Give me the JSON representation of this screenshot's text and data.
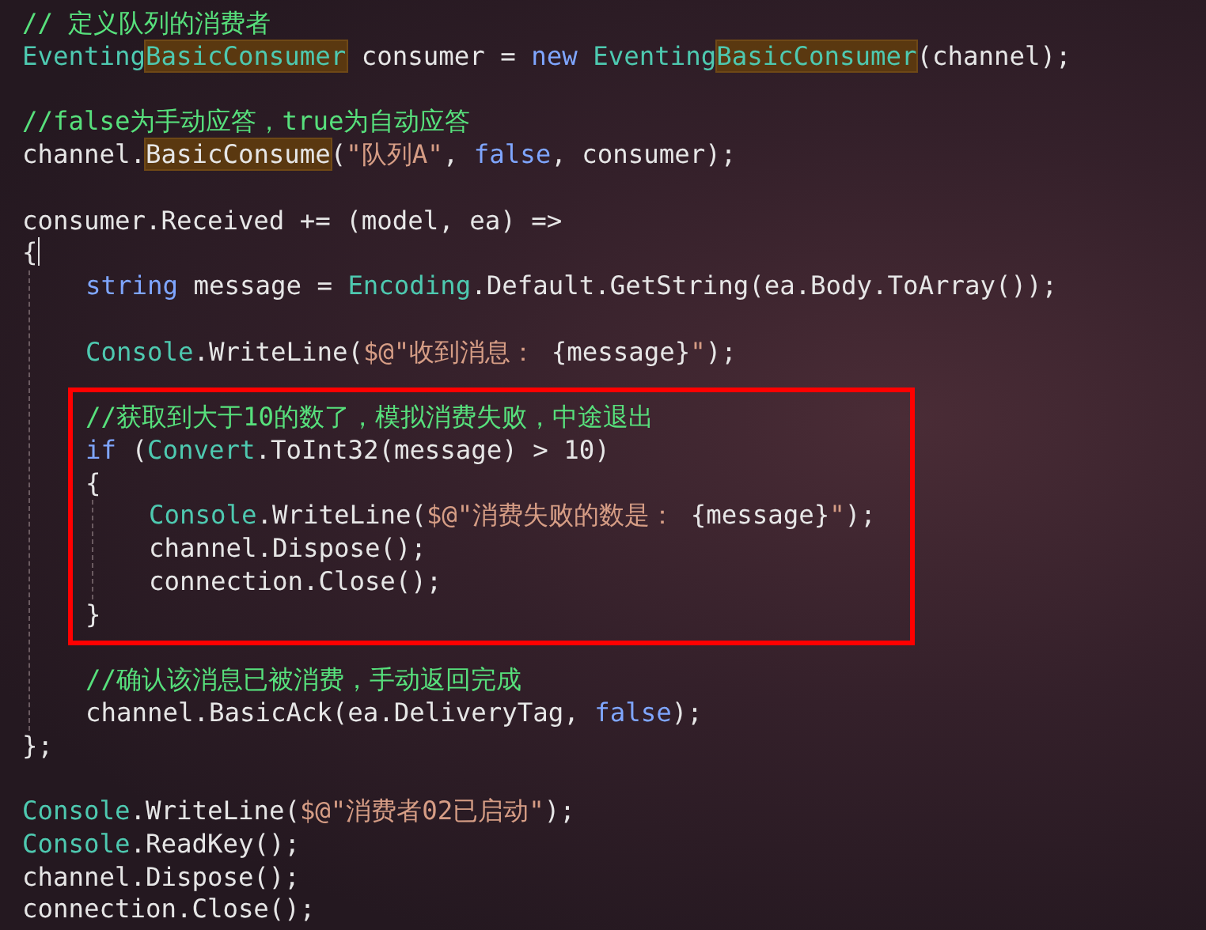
{
  "lines": [
    {
      "kind": "code",
      "tokens": [
        {
          "text": "// 定义队列的消费者",
          "kind": "comment"
        }
      ]
    },
    {
      "kind": "code",
      "tokens": [
        {
          "text": "Eventing",
          "kind": "type"
        },
        {
          "text": "BasicConsumer",
          "kind": "typematch"
        },
        {
          "text": " consumer = ",
          "kind": "plain"
        },
        {
          "text": "new ",
          "kind": "keyword"
        },
        {
          "text": "Eventing",
          "kind": "type"
        },
        {
          "text": "BasicConsumer",
          "kind": "typematch"
        },
        {
          "text": "(channel);",
          "kind": "plain"
        }
      ]
    },
    {
      "kind": "blank"
    },
    {
      "kind": "code",
      "tokens": [
        {
          "text": "//false为手动应答，true为自动应答",
          "kind": "comment"
        }
      ]
    },
    {
      "kind": "code",
      "tokens": [
        {
          "text": "channel.",
          "kind": "plain"
        },
        {
          "text": "BasicConsume",
          "kind": "plainmatch"
        },
        {
          "text": "(",
          "kind": "plain"
        },
        {
          "text": "\"队列A\"",
          "kind": "string"
        },
        {
          "text": ", ",
          "kind": "plain"
        },
        {
          "text": "false",
          "kind": "keyword"
        },
        {
          "text": ", consumer);",
          "kind": "plain"
        }
      ]
    },
    {
      "kind": "blank"
    },
    {
      "kind": "code",
      "tokens": [
        {
          "text": "consumer.Received += (model, ea) =>",
          "kind": "plain"
        }
      ]
    },
    {
      "kind": "code",
      "caret": true,
      "tokens": [
        {
          "text": "{",
          "kind": "plain"
        }
      ],
      "children": [
        {
          "kind": "code",
          "tokens": [
            {
              "text": "string",
              "kind": "keyword"
            },
            {
              "text": " message = ",
              "kind": "plain"
            },
            {
              "text": "Encoding",
              "kind": "type"
            },
            {
              "text": ".Default.GetString(ea.Body.ToArray());",
              "kind": "plain"
            }
          ]
        },
        {
          "kind": "blank"
        },
        {
          "kind": "code",
          "tokens": [
            {
              "text": "Console",
              "kind": "type"
            },
            {
              "text": ".WriteLine(",
              "kind": "plain"
            },
            {
              "text": "$@\"收到消息： ",
              "kind": "string"
            },
            {
              "text": "{message}",
              "kind": "plain"
            },
            {
              "text": "\"",
              "kind": "string"
            },
            {
              "text": ");",
              "kind": "plain"
            }
          ]
        },
        {
          "kind": "blank"
        },
        {
          "kind": "box",
          "children": [
            {
              "kind": "code",
              "tokens": [
                {
                  "text": "//获取到大于10的数了，模拟消费失败，中途退出",
                  "kind": "comment"
                }
              ]
            },
            {
              "kind": "code",
              "tokens": [
                {
                  "text": "if",
                  "kind": "keyword"
                },
                {
                  "text": " (",
                  "kind": "plain"
                },
                {
                  "text": "Convert",
                  "kind": "type"
                },
                {
                  "text": ".ToInt32(message) > 10)",
                  "kind": "plain"
                }
              ]
            },
            {
              "kind": "code",
              "tokens": [
                {
                  "text": "{",
                  "kind": "plain"
                }
              ],
              "children": [
                {
                  "kind": "code",
                  "tokens": [
                    {
                      "text": "Console",
                      "kind": "type"
                    },
                    {
                      "text": ".WriteLine(",
                      "kind": "plain"
                    },
                    {
                      "text": "$@\"消费失败的数是： ",
                      "kind": "string"
                    },
                    {
                      "text": "{message}",
                      "kind": "plain"
                    },
                    {
                      "text": "\"",
                      "kind": "string"
                    },
                    {
                      "text": ");",
                      "kind": "plain"
                    }
                  ]
                },
                {
                  "kind": "code",
                  "tokens": [
                    {
                      "text": "channel.Dispose();",
                      "kind": "plain"
                    }
                  ]
                },
                {
                  "kind": "code",
                  "tokens": [
                    {
                      "text": "connection.Close();",
                      "kind": "plain"
                    }
                  ]
                }
              ]
            },
            {
              "kind": "code",
              "tokens": [
                {
                  "text": "}",
                  "kind": "plain"
                }
              ]
            }
          ]
        },
        {
          "kind": "blank"
        },
        {
          "kind": "code",
          "tokens": [
            {
              "text": "//确认该消息已被消费，手动返回完成",
              "kind": "comment"
            }
          ]
        },
        {
          "kind": "code",
          "tokens": [
            {
              "text": "channel.BasicAck(ea.DeliveryTag, ",
              "kind": "plain"
            },
            {
              "text": "false",
              "kind": "keyword"
            },
            {
              "text": ");",
              "kind": "plain"
            }
          ]
        }
      ]
    },
    {
      "kind": "code",
      "tokens": [
        {
          "text": "};",
          "kind": "plain"
        }
      ]
    },
    {
      "kind": "blank"
    },
    {
      "kind": "code",
      "tokens": [
        {
          "text": "Console",
          "kind": "type"
        },
        {
          "text": ".WriteLine(",
          "kind": "plain"
        },
        {
          "text": "$@\"消费者02已启动\"",
          "kind": "string"
        },
        {
          "text": ");",
          "kind": "plain"
        }
      ]
    },
    {
      "kind": "code",
      "tokens": [
        {
          "text": "Console",
          "kind": "type"
        },
        {
          "text": ".ReadKey();",
          "kind": "plain"
        }
      ]
    },
    {
      "kind": "code",
      "tokens": [
        {
          "text": "channel.Dispose();",
          "kind": "plain"
        }
      ]
    },
    {
      "kind": "code",
      "tokens": [
        {
          "text": "connection.Close();",
          "kind": "plain"
        }
      ]
    }
  ]
}
